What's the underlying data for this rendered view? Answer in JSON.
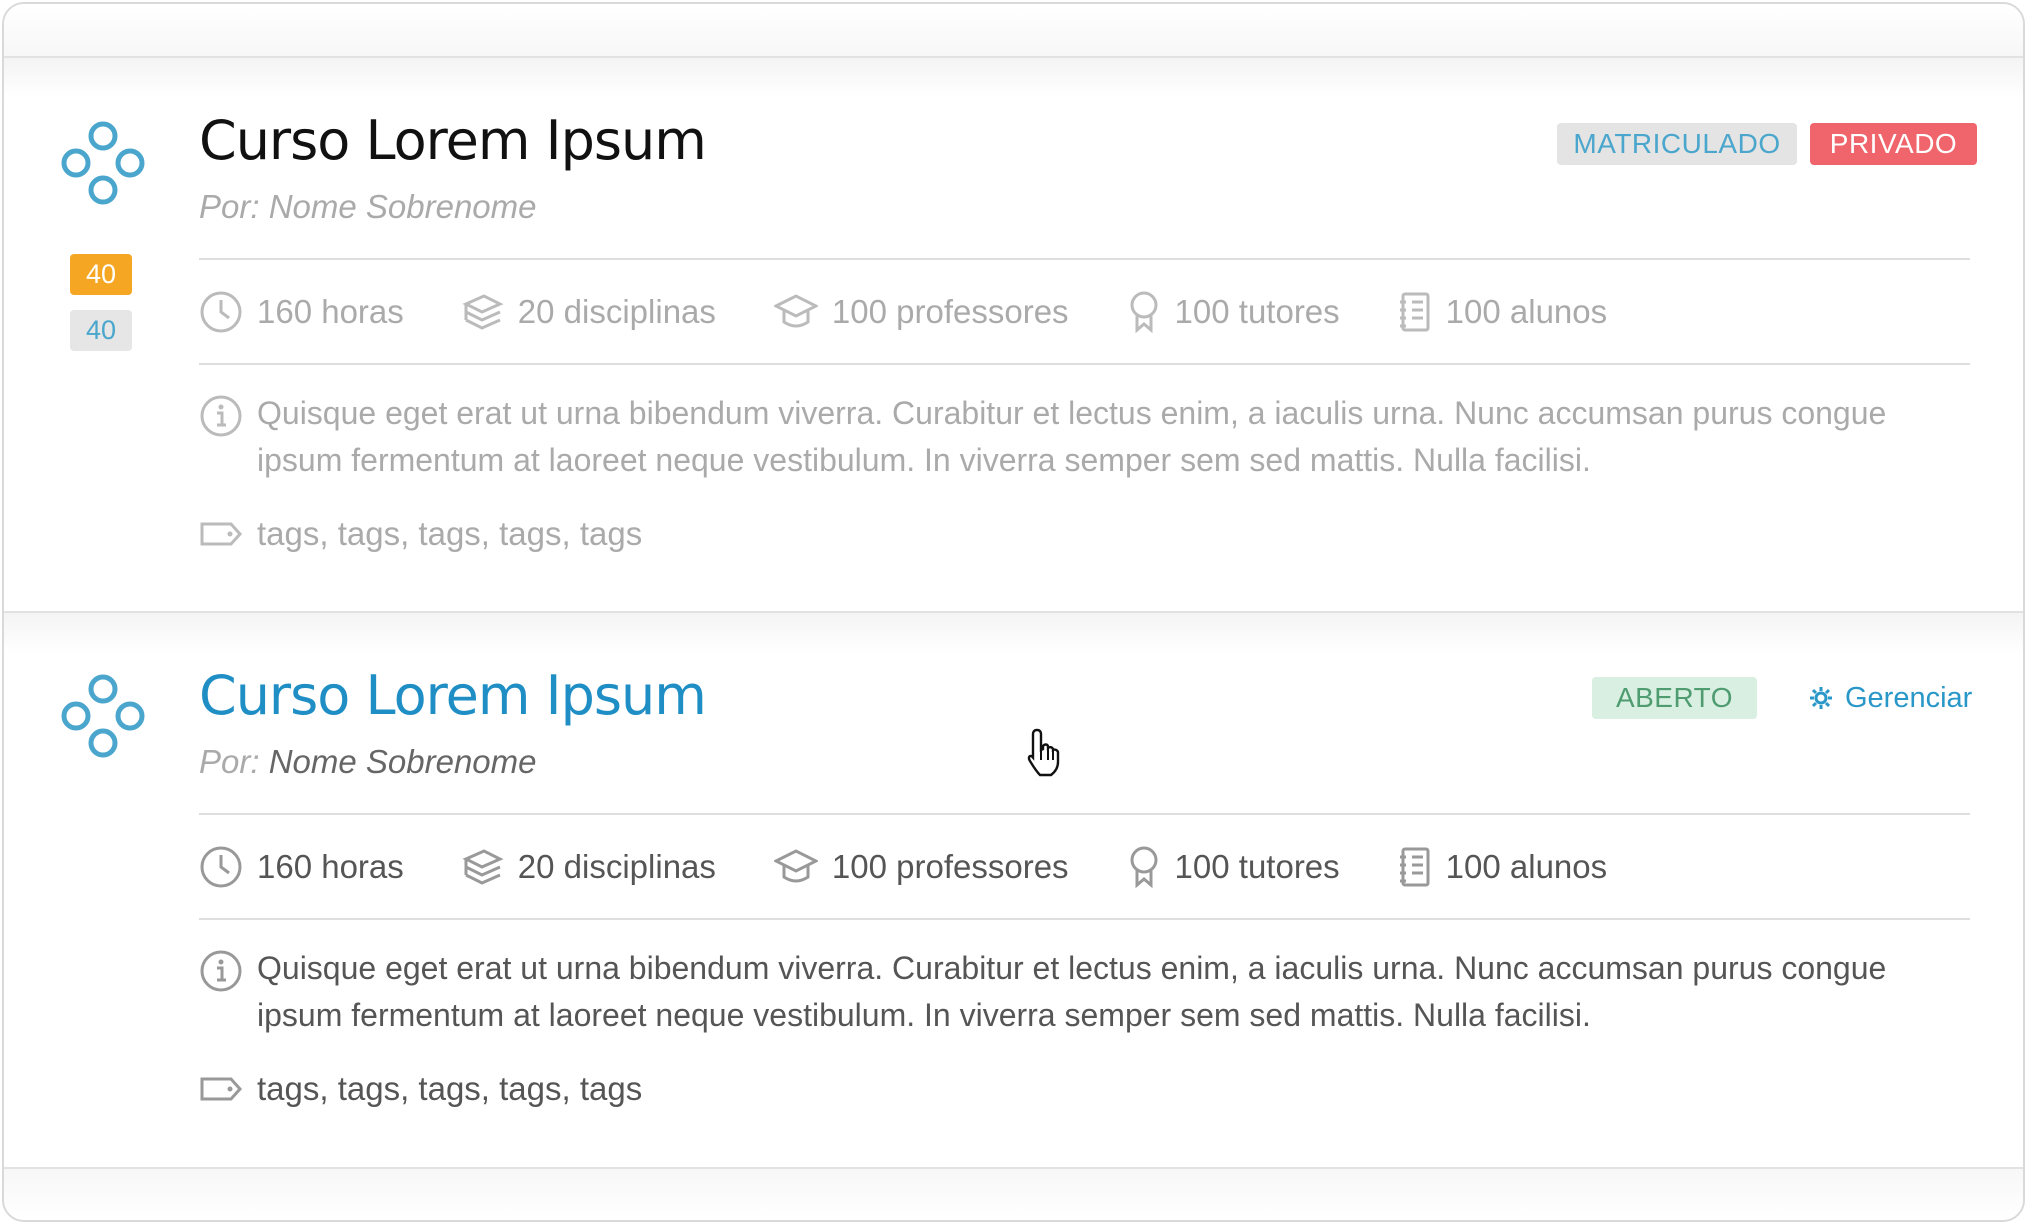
{
  "courses": [
    {
      "title": "Curso Lorem Ipsum",
      "by_label": "Por:",
      "author": "Nome Sobrenome",
      "scores": [
        "40",
        "40"
      ],
      "badges": [
        "MATRICULADO",
        "PRIVADO"
      ],
      "stats": {
        "hours": "160 horas",
        "subjects": "20 disciplinas",
        "teachers": "100 professores",
        "tutors": "100 tutores",
        "students": "100 alunos"
      },
      "description": "Quisque eget erat ut urna bibendum viverra. Curabitur et lectus enim, a iaculis urna. Nunc accumsan purus congue ipsum fermentum at laoreet neque vestibulum. In viverra semper sem sed mattis. Nulla facilisi.",
      "tags": "tags, tags, tags, tags, tags"
    },
    {
      "title": "Curso Lorem Ipsum",
      "by_label": "Por:",
      "author": "Nome Sobrenome",
      "badges": [
        "ABERTO"
      ],
      "manage_label": "Gerenciar",
      "stats": {
        "hours": "160 horas",
        "subjects": "20 disciplinas",
        "teachers": "100 professores",
        "tutors": "100 tutores",
        "students": "100 alunos"
      },
      "description": "Quisque eget erat ut urna bibendum viverra. Curabitur et lectus enim, a iaculis urna. Nunc accumsan purus congue ipsum fermentum at laoreet neque vestibulum. In viverra semper sem sed mattis. Nulla facilisi.",
      "tags": "tags, tags, tags, tags, tags"
    }
  ],
  "icons": {
    "logo": "four-circles-logo-icon",
    "hours": "clock-icon",
    "subjects": "books-icon",
    "teachers": "graduation-cap-icon",
    "tutors": "award-ribbon-icon",
    "students": "notebook-icon",
    "description": "info-icon",
    "tags": "tag-icon",
    "manage": "gear-icon",
    "cursor": "hand-pointer-icon"
  },
  "colors": {
    "accent_blue": "#1e8ec4",
    "logo_blue": "#4aa6cc",
    "score_orange": "#f5a623",
    "private_red": "#f0646b",
    "open_green_bg": "#d9efe2",
    "open_green_text": "#4e9c70"
  }
}
